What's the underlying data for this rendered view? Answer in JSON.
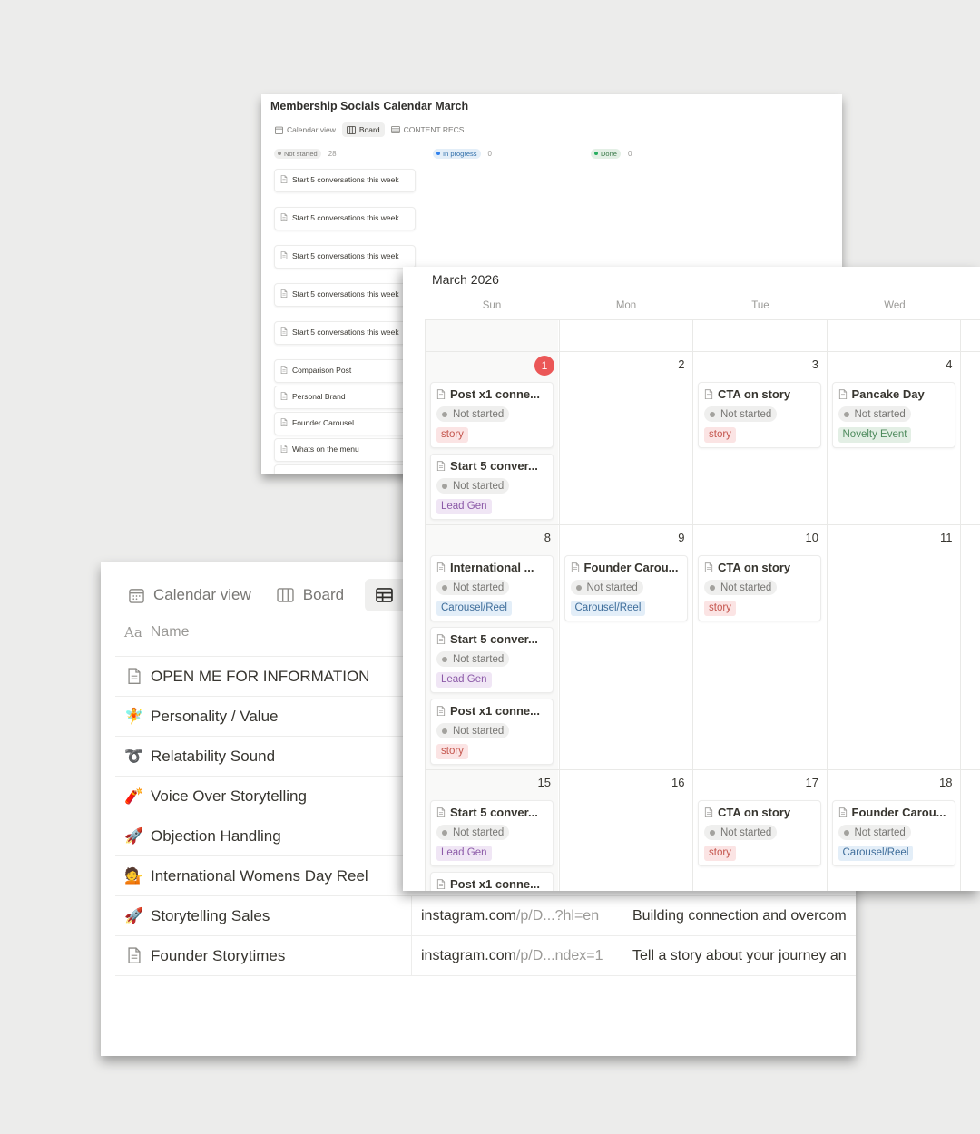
{
  "board": {
    "title": "Membership Socials Calendar March",
    "tabs": [
      {
        "label": "Calendar view",
        "icon": "calendar-icon"
      },
      {
        "label": "Board",
        "icon": "board-icon"
      },
      {
        "label": "CONTENT RECS",
        "icon": "table-icon"
      }
    ],
    "columns": [
      {
        "status": "Not started",
        "count": "28",
        "color": "#9b9a97",
        "bg": "#efefee",
        "text": "#787774"
      },
      {
        "status": "In progress",
        "count": "0",
        "color": "#2f80ed",
        "bg": "#e3eef8",
        "text": "#2f6ea9"
      },
      {
        "status": "Done",
        "count": "0",
        "color": "#27ae60",
        "bg": "#e3efe5",
        "text": "#3b7a4a"
      }
    ],
    "cards": [
      "Start 5 conversations this week",
      "Start 5 conversations this week",
      "Start 5 conversations this week",
      "Start 5 conversations this week",
      "Start 5 conversations this week",
      "Comparison Post",
      "Personal Brand",
      "Founder Carousel",
      "Whats on the menu"
    ]
  },
  "database": {
    "tabs": [
      {
        "label": "Calendar view",
        "icon": "calendar-icon"
      },
      {
        "label": "Board",
        "icon": "board-icon"
      }
    ],
    "name_header": "Name",
    "name_header_icon": "Aa",
    "rows": [
      {
        "name": "OPEN ME FOR INFORMATION",
        "icon": "page-icon",
        "glyph": "",
        "link": "",
        "link_muted": "",
        "desc": ""
      },
      {
        "name": "Personality / Value",
        "icon": "fairy-icon",
        "glyph": "🧚",
        "link": "",
        "link_muted": "",
        "desc": ""
      },
      {
        "name": "Relatability Sound",
        "icon": "loop-icon",
        "glyph": "➰",
        "link": "",
        "link_muted": "",
        "desc": ""
      },
      {
        "name": "Voice Over Storytelling",
        "icon": "firecracker-icon",
        "glyph": "🧨",
        "link": "",
        "link_muted": "",
        "desc": ""
      },
      {
        "name": "Objection Handling",
        "icon": "rocket-icon",
        "glyph": "🚀",
        "link": "",
        "link_muted": "",
        "desc": ""
      },
      {
        "name": "International Womens Day Reel",
        "icon": "woman-icon",
        "glyph": "💁",
        "link": "",
        "link_muted": "",
        "desc": ""
      },
      {
        "name": "Storytelling Sales",
        "icon": "rocket-icon",
        "glyph": "🚀",
        "link": "instagram.com",
        "link_muted": "/p/D...?hl=en",
        "desc": "Building connection and overcom"
      },
      {
        "name": "Founder Storytimes",
        "icon": "page-icon",
        "glyph": "",
        "link": "instagram.com",
        "link_muted": "/p/D...ndex=1",
        "desc": "Tell a story about your journey an"
      }
    ]
  },
  "calendar": {
    "title": "March 2026",
    "weekdays": [
      "Sun",
      "Mon",
      "Tue",
      "Wed"
    ],
    "weeks": [
      {
        "height": 34,
        "days": [
          {
            "date": ""
          },
          {
            "date": ""
          },
          {
            "date": ""
          },
          {
            "date": ""
          }
        ]
      },
      {
        "height": 190,
        "days": [
          {
            "date": "1",
            "today": true,
            "events": [
              {
                "title": "Post x1 conne...",
                "status": "Not started",
                "tag": "story",
                "tag_type": "story"
              },
              {
                "title": "Start 5 conver...",
                "status": "Not started",
                "tag": "Lead Gen",
                "tag_type": "lead"
              }
            ]
          },
          {
            "date": "2",
            "events": []
          },
          {
            "date": "3",
            "events": [
              {
                "title": "CTA on story",
                "status": "Not started",
                "tag": "story",
                "tag_type": "story"
              }
            ]
          },
          {
            "date": "4",
            "events": [
              {
                "title": "Pancake Day",
                "status": "Not started",
                "tag": "Novelty Event",
                "tag_type": "novelty"
              }
            ]
          }
        ]
      },
      {
        "height": 269,
        "days": [
          {
            "date": "8",
            "events": [
              {
                "title": "International ...",
                "status": "Not started",
                "tag": "Carousel/Reel",
                "tag_type": "carousel"
              },
              {
                "title": "Start 5 conver...",
                "status": "Not started",
                "tag": "Lead Gen",
                "tag_type": "lead"
              },
              {
                "title": "Post x1 conne...",
                "status": "Not started",
                "tag": "story",
                "tag_type": "story"
              }
            ]
          },
          {
            "date": "9",
            "events": [
              {
                "title": "Founder Carou...",
                "status": "Not started",
                "tag": "Carousel/Reel",
                "tag_type": "carousel"
              }
            ]
          },
          {
            "date": "10",
            "events": [
              {
                "title": "CTA on story",
                "status": "Not started",
                "tag": "story",
                "tag_type": "story"
              }
            ]
          },
          {
            "date": "11",
            "events": []
          }
        ]
      },
      {
        "height": 140,
        "days": [
          {
            "date": "15",
            "events": [
              {
                "title": "Start 5 conver...",
                "status": "Not started",
                "tag": "Lead Gen",
                "tag_type": "lead"
              },
              {
                "title": "Post x1 conne...",
                "status": "",
                "tag": "",
                "tag_type": ""
              }
            ]
          },
          {
            "date": "16",
            "events": []
          },
          {
            "date": "17",
            "events": [
              {
                "title": "CTA on story",
                "status": "Not started",
                "tag": "story",
                "tag_type": "story"
              }
            ]
          },
          {
            "date": "18",
            "events": [
              {
                "title": "Founder Carou...",
                "status": "Not started",
                "tag": "Carousel/Reel",
                "tag_type": "carousel"
              }
            ]
          }
        ]
      }
    ]
  }
}
